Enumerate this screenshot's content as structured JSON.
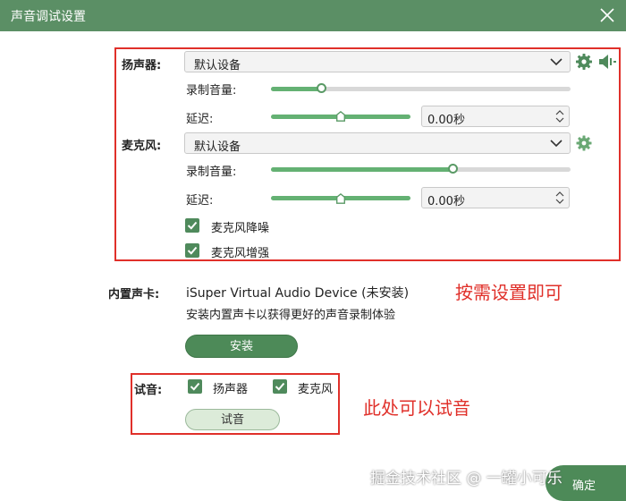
{
  "window": {
    "title": "声音调试设置"
  },
  "speaker": {
    "label": "扬声器:",
    "device": "默认设备",
    "volume_label": "录制音量:",
    "volume_level": 0.17,
    "delay_label": "延迟:",
    "delay_level": 0.5,
    "delay_value": "0.00秒"
  },
  "microphone": {
    "label": "麦克风:",
    "device": "默认设备",
    "volume_label": "录制音量:",
    "volume_level": 0.61,
    "delay_label": "延迟:",
    "delay_level": 0.5,
    "delay_value": "0.00秒",
    "noise_reduction_label": "麦克风降噪",
    "noise_reduction_checked": true,
    "enhance_label": "麦克风增强",
    "enhance_checked": true
  },
  "builtin_card": {
    "label": "内置声卡:",
    "device": "iSuper Virtual Audio Device (未安装)",
    "description": "安装内置声卡以获得更好的声音录制体验",
    "install_label": "安装"
  },
  "test": {
    "label": "试音:",
    "speaker_label": "扬声器",
    "speaker_checked": true,
    "mic_label": "麦克风",
    "mic_checked": true,
    "button_label": "试音"
  },
  "annotations": {
    "settings_note": "按需设置即可",
    "test_note": "此处可以试音"
  },
  "watermark": "掘金技术社区 @ 一罐小可乐",
  "confirm_label": "确定",
  "colors": {
    "accent": "#5b8f65",
    "slider_fill": "#64b173",
    "annotation": "#e0302a"
  },
  "icons": [
    "close-icon",
    "gear-icon",
    "speaker-icon",
    "chevron-down-icon",
    "checkmark-icon"
  ]
}
